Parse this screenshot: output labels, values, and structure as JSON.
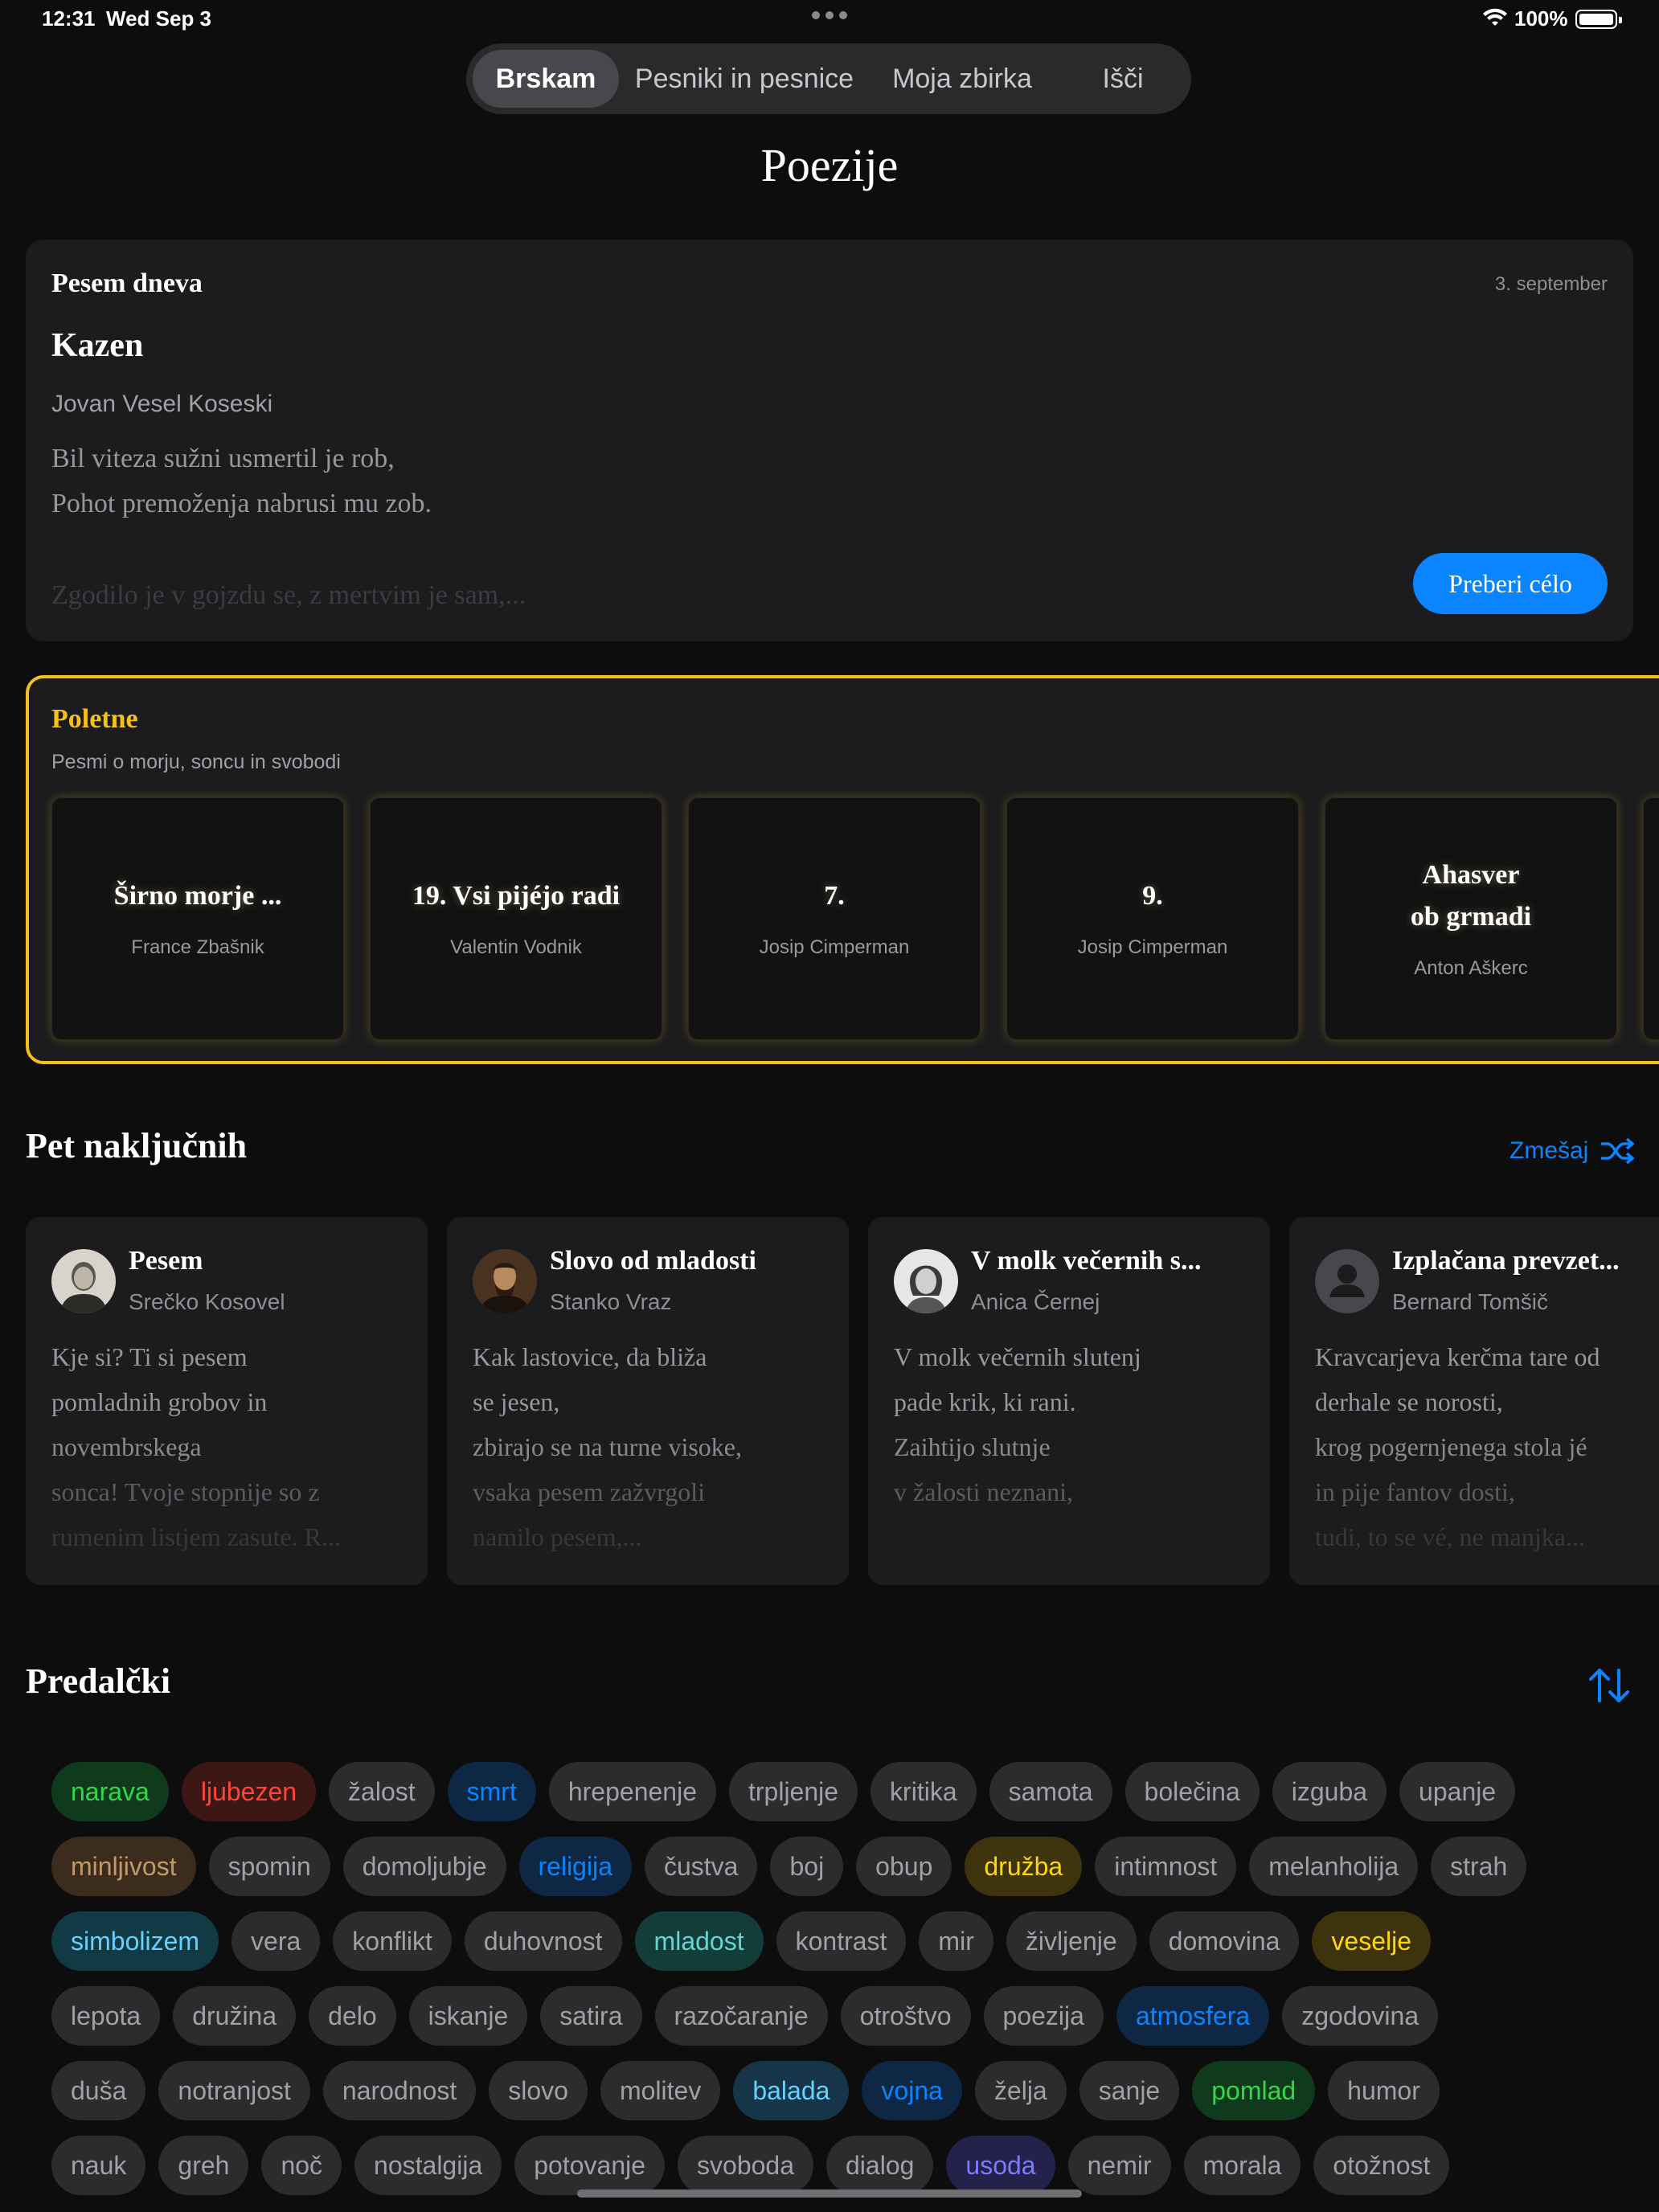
{
  "status_bar": {
    "time": "12:31",
    "date": "Wed Sep 3",
    "battery": "100%"
  },
  "tabs": [
    {
      "label": "Brskam",
      "active": true
    },
    {
      "label": "Pesniki in pesnice",
      "active": false
    },
    {
      "label": "Moja zbirka",
      "active": false
    },
    {
      "label": "Išči",
      "active": false
    }
  ],
  "page_title": "Poezije",
  "poem_of_day": {
    "label": "Pesem dneva",
    "date": "3. september",
    "title": "Kazen",
    "author": "Jovan Vesel Koseski",
    "lines": [
      "Bil viteza sužni usmertil je rob,",
      "Pohot premoženja nabrusi mu zob.",
      "Zgodilo je v gojzdu se, z mertvim je sam,..."
    ],
    "read_button": "Preberi célo"
  },
  "summer": {
    "title": "Poletne",
    "subtitle": "Pesmi o morju, soncu in svobodi",
    "accent": "#f4c01e",
    "cards": [
      {
        "title": "Širno morje ...",
        "author": "France Zbašnik"
      },
      {
        "title": "19. Vsi pijéjo radi",
        "author": "Valentin Vodnik"
      },
      {
        "title": "7.",
        "author": "Josip Cimperman"
      },
      {
        "title": "9.",
        "author": "Josip Cimperman"
      },
      {
        "title_line1": "Ahasver",
        "title_line2": "ob grmadi",
        "author": "Anton Aškerc"
      }
    ]
  },
  "random": {
    "title": "Pet naključnih",
    "shuffle_label": "Zmešaj",
    "cards": [
      {
        "title": "Pesem",
        "author": "Srečko Kosovel",
        "avatar": "portrait-photo",
        "lines": [
          "Kje si? Ti si pesem",
          "pomladnih grobov in",
          "novembrskega",
          "sonca! Tvoje stopnije so z",
          "rumenim listjem zasute. R..."
        ]
      },
      {
        "title": "Slovo od mladosti",
        "author": "Stanko Vraz",
        "avatar": "portrait-painting",
        "lines": [
          "Kak lastovice, da bliža",
          "se jesen,",
          "zbirajo se na turne visoke,",
          "vsaka pesem zažvrgoli",
          "namilo pesem,..."
        ]
      },
      {
        "title": "V molk večernih s...",
        "author": "Anica Černej",
        "avatar": "portrait-photo",
        "lines": [
          "V molk večernih slutenj",
          "pade krik, ki rani.",
          "Zaihtijo slutnje",
          "v žalosti neznani,"
        ]
      },
      {
        "title": "Izplačana prevzet...",
        "author": "Bernard Tomšič",
        "avatar": "person-placeholder-icon",
        "lines": [
          "Kravcarjeva kerčma tare od",
          "derhale se norosti,",
          "krog pogernjenega stola jé",
          "in pije fantov dosti,",
          "tudi, to se vé, ne manjka..."
        ]
      }
    ]
  },
  "drawers": {
    "title": "Predalčki",
    "rows": [
      [
        {
          "label": "narava",
          "color": "green"
        },
        {
          "label": "ljubezen",
          "color": "red"
        },
        {
          "label": "žalost"
        },
        {
          "label": "smrt",
          "color": "blue"
        },
        {
          "label": "hrepenenje"
        },
        {
          "label": "trpljenje"
        },
        {
          "label": "kritika"
        },
        {
          "label": "samota"
        },
        {
          "label": "bolečina"
        },
        {
          "label": "izguba"
        },
        {
          "label": "upanje"
        }
      ],
      [
        {
          "label": "minljivost",
          "color": "brown"
        },
        {
          "label": "spomin"
        },
        {
          "label": "domoljubje"
        },
        {
          "label": "religija",
          "color": "blue"
        },
        {
          "label": "čustva"
        },
        {
          "label": "boj"
        },
        {
          "label": "obup"
        },
        {
          "label": "družba",
          "color": "yellow"
        },
        {
          "label": "intimnost"
        },
        {
          "label": "melanholija"
        },
        {
          "label": "strah"
        }
      ],
      [
        {
          "label": "simbolizem",
          "color": "teal"
        },
        {
          "label": "vera"
        },
        {
          "label": "konflikt"
        },
        {
          "label": "duhovnost"
        },
        {
          "label": "mladost",
          "color": "mint"
        },
        {
          "label": "kontrast"
        },
        {
          "label": "mir"
        },
        {
          "label": "življenje"
        },
        {
          "label": "domovina"
        },
        {
          "label": "veselje",
          "color": "yellow"
        }
      ],
      [
        {
          "label": "lepota"
        },
        {
          "label": "družina"
        },
        {
          "label": "delo"
        },
        {
          "label": "iskanje"
        },
        {
          "label": "satira"
        },
        {
          "label": "razočaranje"
        },
        {
          "label": "otroštvo"
        },
        {
          "label": "poezija"
        },
        {
          "label": "atmosfera",
          "color": "blue"
        },
        {
          "label": "zgodovina"
        }
      ],
      [
        {
          "label": "duša"
        },
        {
          "label": "notranjost"
        },
        {
          "label": "narodnost"
        },
        {
          "label": "slovo"
        },
        {
          "label": "molitev"
        },
        {
          "label": "balada",
          "color": "sky"
        },
        {
          "label": "vojna",
          "color": "blue"
        },
        {
          "label": "želja"
        },
        {
          "label": "sanje"
        },
        {
          "label": "pomlad",
          "color": "green"
        },
        {
          "label": "humor"
        }
      ],
      [
        {
          "label": "nauk"
        },
        {
          "label": "greh"
        },
        {
          "label": "noč"
        },
        {
          "label": "nostalgija"
        },
        {
          "label": "potovanje"
        },
        {
          "label": "svoboda"
        },
        {
          "label": "dialog"
        },
        {
          "label": "usoda",
          "color": "indigo"
        },
        {
          "label": "nemir"
        },
        {
          "label": "morala"
        },
        {
          "label": "otožnost"
        }
      ]
    ]
  },
  "colors": {
    "accent": "#0a84ff",
    "summer": "#f4c01e",
    "background": "#0d0d0d",
    "card": "#1c1c1e"
  }
}
